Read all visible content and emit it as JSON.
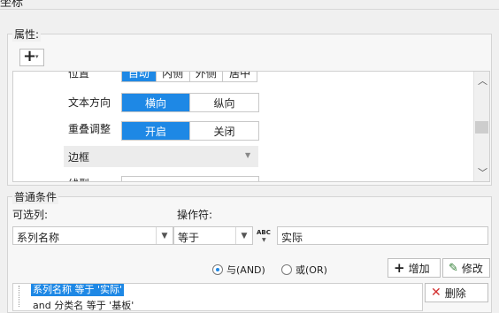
{
  "dialog": {
    "title": "坐标"
  },
  "props": {
    "title": "属性:",
    "add_plus": "+",
    "add_arrow": "▾",
    "position": {
      "label": "位置",
      "options": [
        "自动",
        "内侧",
        "外侧",
        "居中"
      ]
    },
    "text_dir": {
      "label": "文本方向",
      "options": [
        "横向",
        "纵向"
      ],
      "selected": "横向"
    },
    "overlap": {
      "label": "重叠调整",
      "options": [
        "开启",
        "关闭"
      ],
      "selected": "开启"
    },
    "border": {
      "label": "边框",
      "arrow": "▼"
    },
    "line_label": "线型"
  },
  "cond": {
    "title": "普通条件",
    "optional_col_label": "可选列:",
    "operator_label": "操作符:",
    "column_value": "系列名称",
    "operator_value": "等于",
    "abc_icon_text": "ABC",
    "value_input": "实际",
    "radio_and": "与(AND)",
    "radio_or": "或(OR)",
    "add_button": "增加",
    "modify_button": "修改",
    "delete_button": "删除",
    "list": [
      "系列名称 等于 '实际'",
      "and 分类名 等于 '基板'"
    ]
  },
  "colors": {
    "accent": "#1e88e5",
    "delete": "#d32f2f",
    "modify": "#2e7d32"
  }
}
